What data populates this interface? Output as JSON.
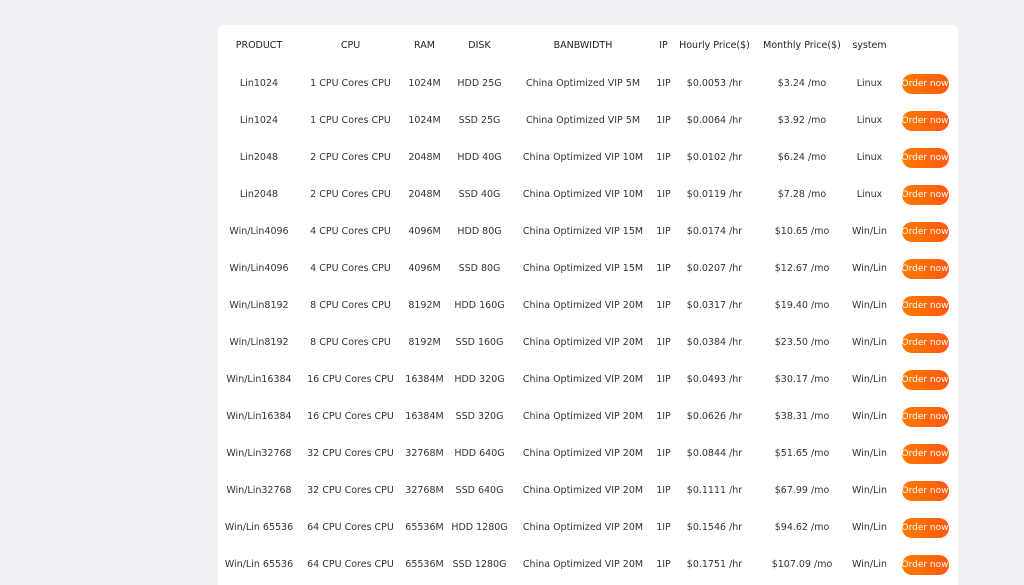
{
  "table": {
    "headers": [
      "PRODUCT",
      "CPU",
      "RAM",
      "DISK",
      "BANBWIDTH",
      "IP",
      "Hourly Price($)",
      "Monthly Price($)",
      "system",
      ""
    ],
    "order_label": "Order now",
    "rows": [
      {
        "product": "Lin1024",
        "cpu": "1 CPU Cores CPU",
        "ram": "1024M",
        "disk": "HDD 25G",
        "bandwidth": "China Optimized VIP 5M",
        "ip": "1IP",
        "hourly": "$0.0053 /hr",
        "monthly": "$3.24 /mo",
        "system": "Linux"
      },
      {
        "product": "Lin1024",
        "cpu": "1 CPU Cores CPU",
        "ram": "1024M",
        "disk": "SSD 25G",
        "bandwidth": "China Optimized VIP 5M",
        "ip": "1IP",
        "hourly": "$0.0064 /hr",
        "monthly": "$3.92 /mo",
        "system": "Linux"
      },
      {
        "product": "Lin2048",
        "cpu": "2 CPU Cores CPU",
        "ram": "2048M",
        "disk": "HDD 40G",
        "bandwidth": "China Optimized VIP 10M",
        "ip": "1IP",
        "hourly": "$0.0102 /hr",
        "monthly": "$6.24 /mo",
        "system": "Linux"
      },
      {
        "product": "Lin2048",
        "cpu": "2 CPU Cores CPU",
        "ram": "2048M",
        "disk": "SSD 40G",
        "bandwidth": "China Optimized VIP 10M",
        "ip": "1IP",
        "hourly": "$0.0119 /hr",
        "monthly": "$7.28 /mo",
        "system": "Linux"
      },
      {
        "product": "Win/Lin4096",
        "cpu": "4 CPU Cores CPU",
        "ram": "4096M",
        "disk": "HDD 80G",
        "bandwidth": "China Optimized VIP 15M",
        "ip": "1IP",
        "hourly": "$0.0174 /hr",
        "monthly": "$10.65 /mo",
        "system": "Win/Lin"
      },
      {
        "product": "Win/Lin4096",
        "cpu": "4 CPU Cores CPU",
        "ram": "4096M",
        "disk": "SSD 80G",
        "bandwidth": "China Optimized VIP 15M",
        "ip": "1IP",
        "hourly": "$0.0207 /hr",
        "monthly": "$12.67 /mo",
        "system": "Win/Lin"
      },
      {
        "product": "Win/Lin8192",
        "cpu": "8 CPU Cores CPU",
        "ram": "8192M",
        "disk": "HDD 160G",
        "bandwidth": "China Optimized VIP 20M",
        "ip": "1IP",
        "hourly": "$0.0317 /hr",
        "monthly": "$19.40 /mo",
        "system": "Win/Lin"
      },
      {
        "product": "Win/Lin8192",
        "cpu": "8 CPU Cores CPU",
        "ram": "8192M",
        "disk": "SSD 160G",
        "bandwidth": "China Optimized VIP 20M",
        "ip": "1IP",
        "hourly": "$0.0384 /hr",
        "monthly": "$23.50 /mo",
        "system": "Win/Lin"
      },
      {
        "product": "Win/Lin16384",
        "cpu": "16 CPU Cores CPU",
        "ram": "16384M",
        "disk": "HDD 320G",
        "bandwidth": "China Optimized VIP 20M",
        "ip": "1IP",
        "hourly": "$0.0493 /hr",
        "monthly": "$30.17 /mo",
        "system": "Win/Lin"
      },
      {
        "product": "Win/Lin16384",
        "cpu": "16 CPU Cores CPU",
        "ram": "16384M",
        "disk": "SSD 320G",
        "bandwidth": "China Optimized VIP 20M",
        "ip": "1IP",
        "hourly": "$0.0626 /hr",
        "monthly": "$38.31 /mo",
        "system": "Win/Lin"
      },
      {
        "product": "Win/Lin32768",
        "cpu": "32 CPU Cores CPU",
        "ram": "32768M",
        "disk": "HDD 640G",
        "bandwidth": "China Optimized VIP 20M",
        "ip": "1IP",
        "hourly": "$0.0844 /hr",
        "monthly": "$51.65 /mo",
        "system": "Win/Lin"
      },
      {
        "product": "Win/Lin32768",
        "cpu": "32 CPU Cores CPU",
        "ram": "32768M",
        "disk": "SSD 640G",
        "bandwidth": "China Optimized VIP 20M",
        "ip": "1IP",
        "hourly": "$0.1111 /hr",
        "monthly": "$67.99 /mo",
        "system": "Win/Lin"
      },
      {
        "product": "Win/Lin 65536",
        "cpu": "64 CPU Cores CPU",
        "ram": "65536M",
        "disk": "HDD 1280G",
        "bandwidth": "China Optimized VIP 20M",
        "ip": "1IP",
        "hourly": "$0.1546 /hr",
        "monthly": "$94.62 /mo",
        "system": "Win/Lin"
      },
      {
        "product": "Win/Lin 65536",
        "cpu": "64 CPU Cores CPU",
        "ram": "65536M",
        "disk": "SSD 1280G",
        "bandwidth": "China Optimized VIP 20M",
        "ip": "1IP",
        "hourly": "$0.1751 /hr",
        "monthly": "$107.09 /mo",
        "system": "Win/Lin"
      }
    ]
  },
  "colors": {
    "page_background": "#eff1f5",
    "card_background": "#ffffff",
    "button_gradient_start": "#ff7a00",
    "button_gradient_end": "#ff5a12",
    "button_text": "#ffffff"
  }
}
